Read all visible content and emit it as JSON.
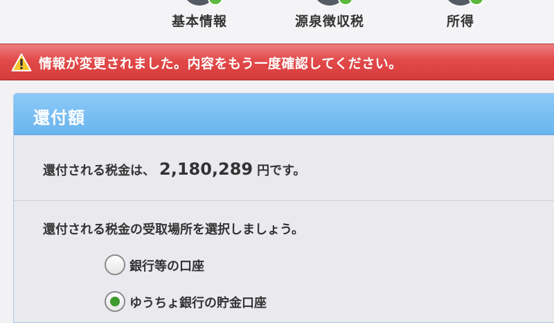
{
  "steps": [
    {
      "label": "基本情報"
    },
    {
      "label": "源泉徴収税"
    },
    {
      "label": "所得"
    }
  ],
  "alert": {
    "icon": "warning-icon",
    "message": "情報が変更されました。内容をもう一度確認してください。"
  },
  "refund": {
    "title": "還付額",
    "prefix": "還付される税金は、",
    "amount": "2,180,289",
    "suffix": "円です。",
    "choose_prompt": "還付される税金の受取場所を選択しましょう。",
    "options": [
      {
        "label": "銀行等の口座",
        "selected": false
      },
      {
        "label": "ゆうちょ銀行の貯金口座",
        "selected": true
      }
    ]
  },
  "colors": {
    "alert_red": "#e24a4a",
    "header_blue": "#6ab4ef",
    "check_green": "#5cb93e",
    "radio_selected": "#3e9a2c"
  }
}
